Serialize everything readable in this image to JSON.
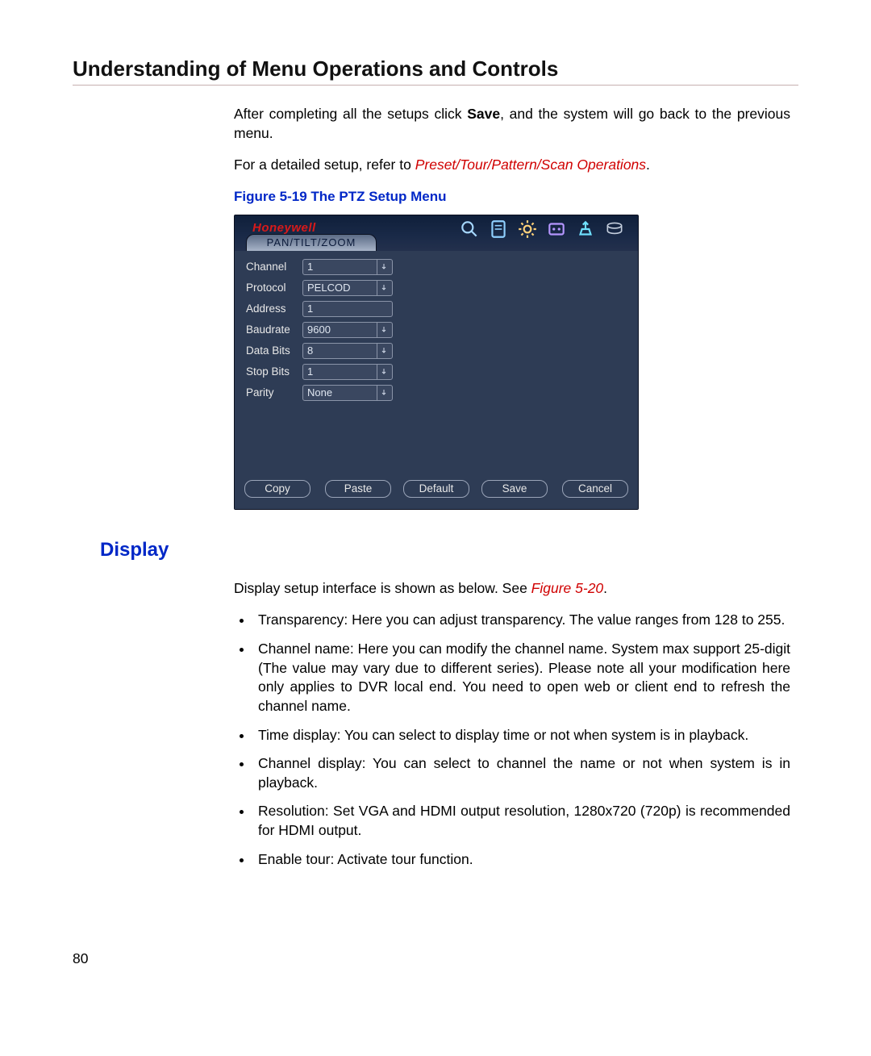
{
  "header": {
    "title": "Understanding of Menu Operations and Controls"
  },
  "intro": {
    "before_bold": "After completing all the setups click ",
    "bold": "Save",
    "after_bold": ", and the system will go back to the previous menu.",
    "detailed_prefix": "For a detailed setup, refer to ",
    "detailed_link": "Preset/Tour/Pattern/Scan Operations",
    "detailed_suffix": "."
  },
  "figure_caption": "Figure 5-19 The PTZ Setup Menu",
  "dvr": {
    "logo": "Honeywell",
    "tab": "PAN/TILT/ZOOM",
    "fields": {
      "channel": {
        "label": "Channel",
        "value": "1",
        "dropdown": true
      },
      "protocol": {
        "label": "Protocol",
        "value": "PELCOD",
        "dropdown": true
      },
      "address": {
        "label": "Address",
        "value": "1",
        "dropdown": false
      },
      "baudrate": {
        "label": "Baudrate",
        "value": "9600",
        "dropdown": true
      },
      "databits": {
        "label": "Data Bits",
        "value": "8",
        "dropdown": true
      },
      "stopbits": {
        "label": "Stop Bits",
        "value": "1",
        "dropdown": true
      },
      "parity": {
        "label": "Parity",
        "value": "None",
        "dropdown": true
      }
    },
    "buttons": {
      "copy": "Copy",
      "paste": "Paste",
      "default": "Default",
      "save": "Save",
      "cancel": "Cancel"
    }
  },
  "section_title": "Display",
  "display_intro_prefix": "Display setup interface is shown as below. See ",
  "display_intro_link": "Figure 5-20",
  "display_intro_suffix": ".",
  "bullets": {
    "b1": "Transparency: Here you can adjust transparency. The value ranges from 128 to 255.",
    "b2": "Channel name: Here you can modify the channel name. System max support 25-digit (The value may vary due to different series). Please note all your modification here only applies to DVR local end. You need to open web or client end to refresh the channel name.",
    "b3": "Time display: You can select to display time or not when system is in playback.",
    "b4": "Channel display: You can select to channel the name or not when system is  in playback.",
    "b5": "Resolution: Set VGA and HDMI output resolution, 1280x720 (720p) is recommended for HDMI output.",
    "b6": "Enable tour: Activate tour function."
  },
  "page_number": "80"
}
